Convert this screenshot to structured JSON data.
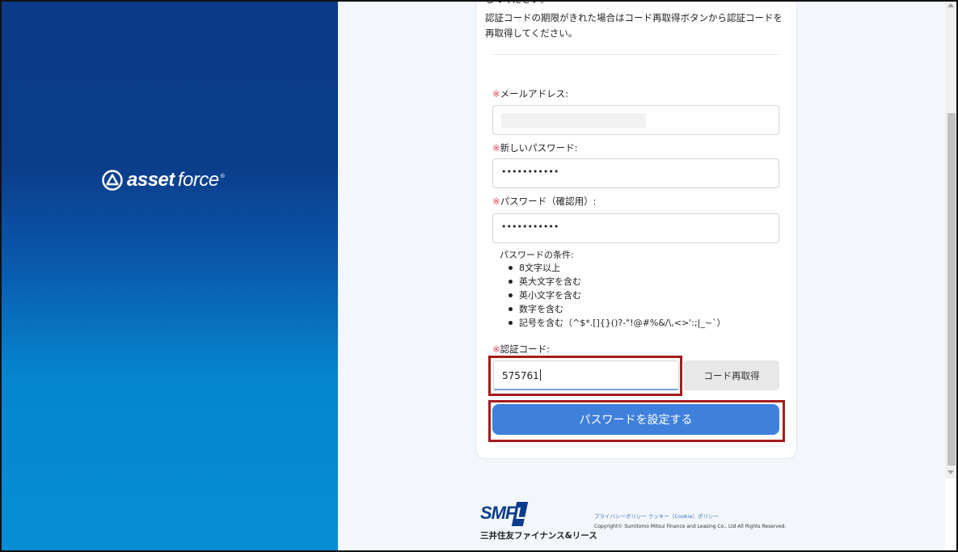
{
  "brand": {
    "logo_asset": "asset",
    "logo_force": "force",
    "logo_reg": "®",
    "accent_color": "#3f80dc"
  },
  "instructions": {
    "line_cut": "してください。",
    "line1": "認証コードの期限がきれた場合はコード再取得ボタンから認証コードを",
    "line2": "再取得してください。"
  },
  "form": {
    "required_mark": "※",
    "email_label": "メールアドレス:",
    "new_password_label": "新しいパスワード:",
    "new_password_value": "•••••••••••",
    "confirm_password_label": "パスワード（確認用）:",
    "confirm_password_value": "•••••••••••",
    "conditions_title": "パスワードの条件:",
    "conditions": [
      "8文字以上",
      "英大文字を含む",
      "英小文字を含む",
      "数字を含む",
      "記号を含む（^$*.[]{}()?-\"!@#%&/\\,<>':;|_~`）"
    ],
    "code_label": "認証コード:",
    "code_value": "575761",
    "resend_button": "コード再取得",
    "submit_button": "パスワードを設定する"
  },
  "footer": {
    "smfl_logo": "SMF",
    "smfl_logo_l": "L",
    "company_name": "三井住友ファイナンス&リース",
    "links": "プライバシーポリシー  クッキー（Cookie）ポリシー",
    "copyright": "Copyright© Sumitomo Mitsui Finance and Leasing Co., Ltd All Rights Reserved."
  }
}
